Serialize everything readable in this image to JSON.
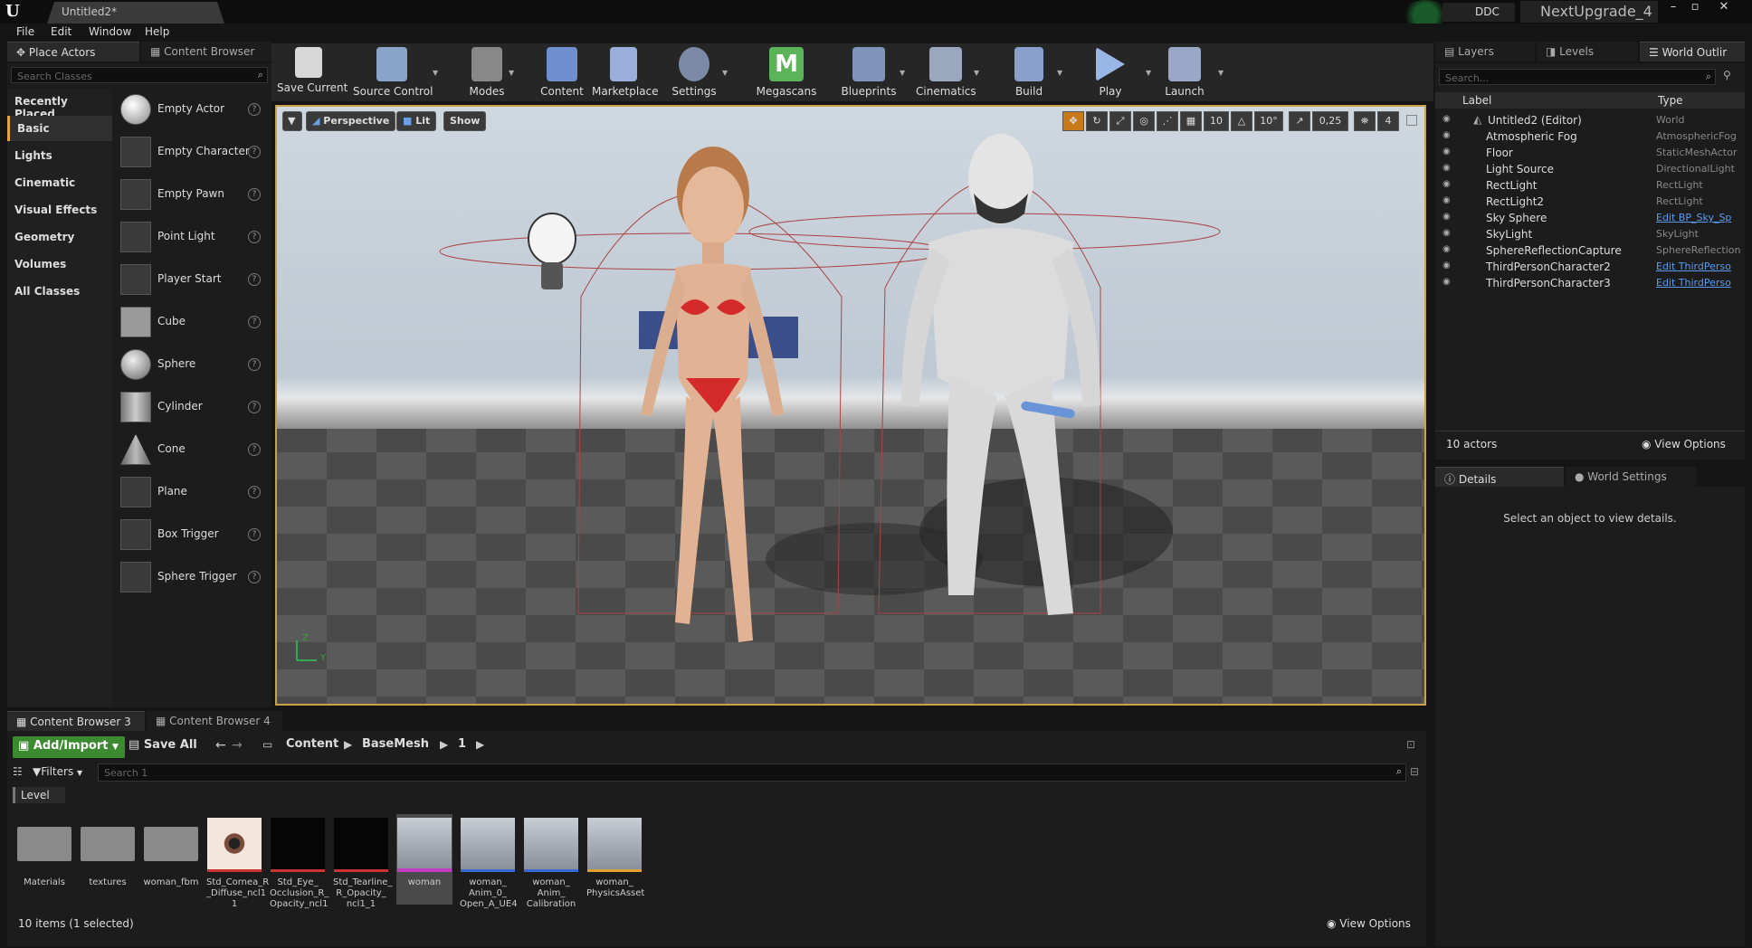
{
  "titlebar": {
    "logo": "U",
    "doc_tab": "Untitled2*",
    "ddc_label": "DDC",
    "project": "NextUpgrade_4",
    "minimize": "–",
    "maximize": "▫",
    "close": "✕"
  },
  "menubar": {
    "items": [
      "File",
      "Edit",
      "Window",
      "Help"
    ]
  },
  "left_tabs": {
    "place_actors": "Place Actors",
    "content_browser": "Content Browser"
  },
  "place_actors": {
    "search_placeholder": "Search Classes",
    "categories": [
      "Recently Placed",
      "Basic",
      "Lights",
      "Cinematic",
      "Visual Effects",
      "Geometry",
      "Volumes",
      "All Classes"
    ],
    "active_category": "Basic",
    "actors": [
      "Empty Actor",
      "Empty Character",
      "Empty Pawn",
      "Point Light",
      "Player Start",
      "Cube",
      "Sphere",
      "Cylinder",
      "Cone",
      "Plane",
      "Box Trigger",
      "Sphere Trigger"
    ],
    "help_glyph": "?"
  },
  "toolbar": {
    "buttons": [
      "Save Current",
      "Source Control",
      "Modes",
      "Content",
      "Marketplace",
      "Settings",
      "Megascans",
      "Blueprints",
      "Cinematics",
      "Build",
      "Play",
      "Launch"
    ],
    "megascans_icon_letter": "M",
    "dropdown_glyph": "▼"
  },
  "viewport": {
    "menu_glyph": "▼",
    "perspective": "Perspective",
    "lit": "Lit",
    "show": "Show",
    "grid_snap": "10",
    "rotation_snap": "10°",
    "scale_snap": "0,25",
    "camera_speed": "4",
    "axis_z": "Z",
    "axis_y": "Y",
    "accent_color": "#c9a24a"
  },
  "outliner": {
    "tabs": [
      "Layers",
      "Levels",
      "World Outlir"
    ],
    "search_placeholder": "Search...",
    "col_label": "Label",
    "col_type": "Type",
    "rows": [
      {
        "label": "Untitled2 (Editor)",
        "type": "World"
      },
      {
        "label": "Atmospheric Fog",
        "type": "AtmosphericFog"
      },
      {
        "label": "Floor",
        "type": "StaticMeshActor"
      },
      {
        "label": "Light Source",
        "type": "DirectionalLight"
      },
      {
        "label": "RectLight",
        "type": "RectLight"
      },
      {
        "label": "RectLight2",
        "type": "RectLight"
      },
      {
        "label": "Sky Sphere",
        "type": "Edit BP_Sky_Sp"
      },
      {
        "label": "SkyLight",
        "type": "SkyLight"
      },
      {
        "label": "SphereReflectionCapture",
        "type": "SphereReflection"
      },
      {
        "label": "ThirdPersonCharacter2",
        "type": "Edit ThirdPerso"
      },
      {
        "label": "ThirdPersonCharacter3",
        "type": "Edit ThirdPerso"
      }
    ],
    "actor_count": "10 actors",
    "view_options": "View Options"
  },
  "details": {
    "tabs": [
      "Details",
      "World Settings"
    ],
    "empty_message": "Select an object to view details."
  },
  "content_browser": {
    "tabs": [
      "Content Browser 3",
      "Content Browser 4"
    ],
    "add_import": "Add/Import",
    "save_all": "Save All",
    "path": [
      "Content",
      "BaseMesh",
      "1"
    ],
    "filters": "Filters",
    "search_placeholder": "Search 1",
    "filter_chip": "Level",
    "assets": [
      {
        "name": "Materials",
        "kind": "folder"
      },
      {
        "name": "textures",
        "kind": "folder"
      },
      {
        "name": "woman_fbm",
        "kind": "folder"
      },
      {
        "name": "Std_Cornea_R _Diffuse_ncl1 1",
        "kind": "texture-eye"
      },
      {
        "name": "Std_Eye_ Occlusion_R_ Opacity_ncl1",
        "kind": "texture-black"
      },
      {
        "name": "Std_Tearline_ R_Opacity_ ncl1_1",
        "kind": "texture-black"
      },
      {
        "name": "woman",
        "kind": "mesh-selected"
      },
      {
        "name": "woman_ Anim_0_ Open_A_UE4",
        "kind": "mesh"
      },
      {
        "name": "woman_ Anim_ Calibration",
        "kind": "mesh"
      },
      {
        "name": "woman_ PhysicsAsset",
        "kind": "mesh"
      }
    ],
    "status": "10 items (1 selected)",
    "view_options": "View Options"
  }
}
